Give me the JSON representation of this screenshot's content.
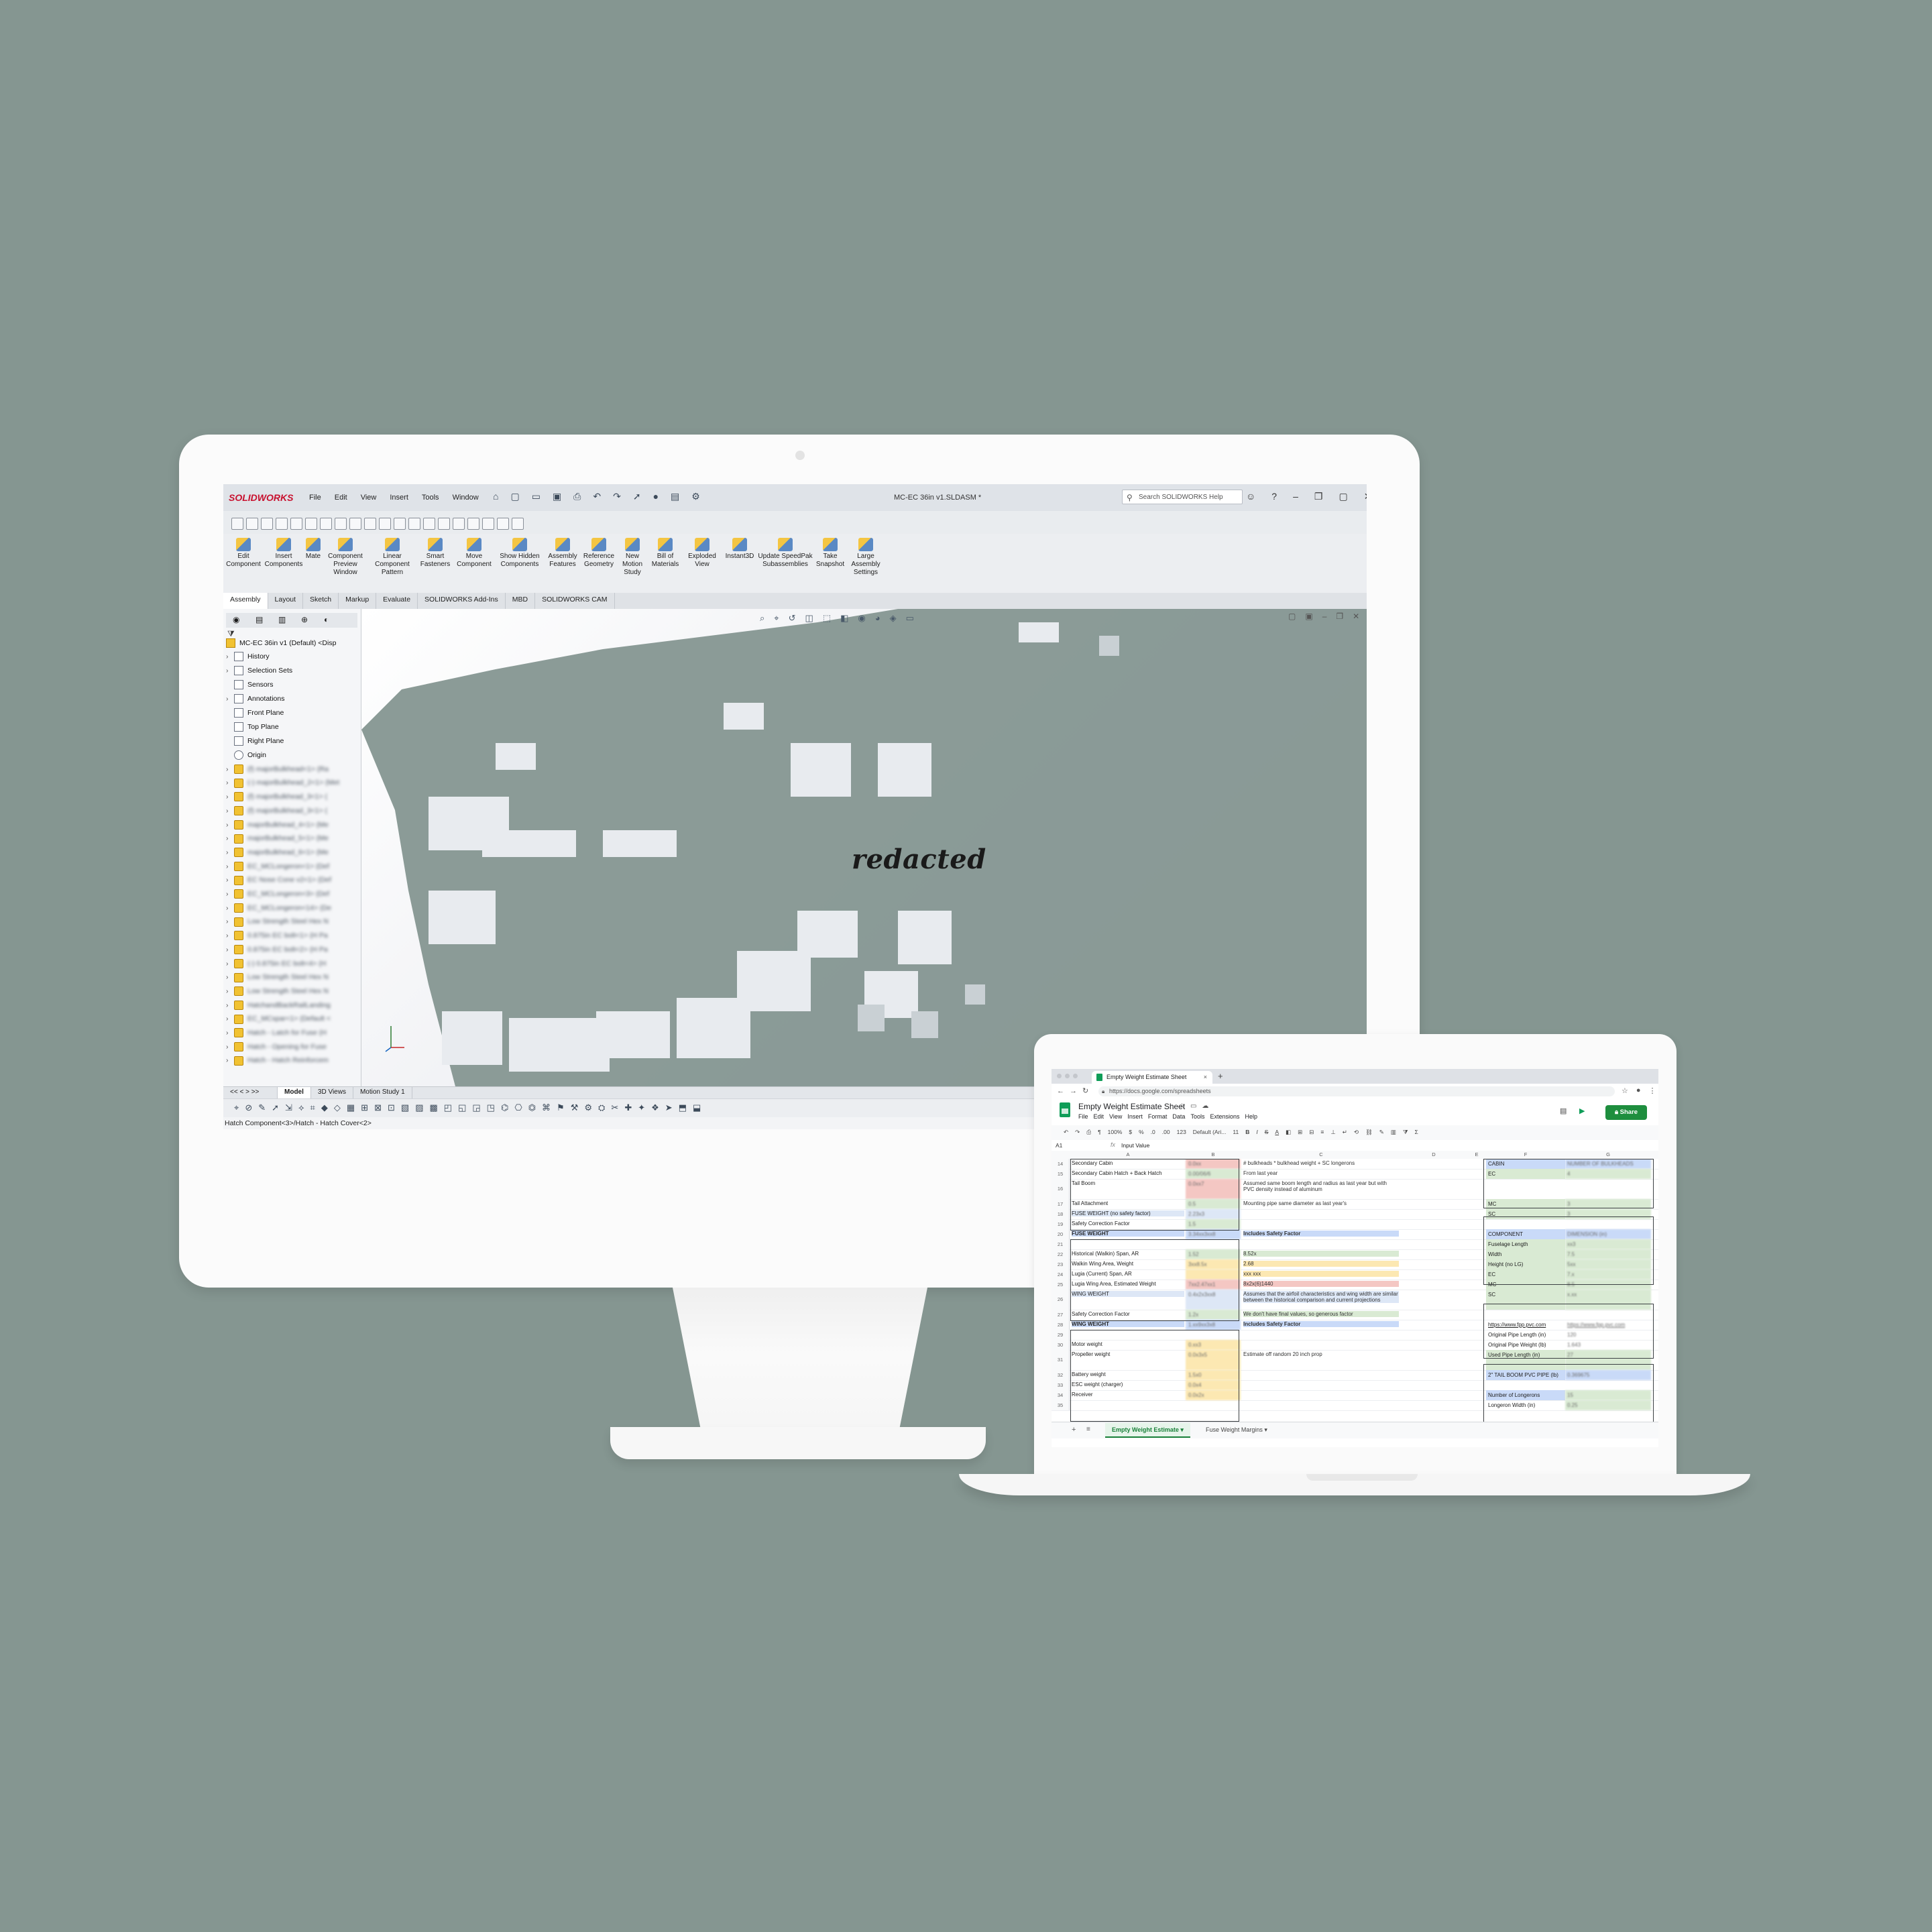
{
  "solidworks": {
    "logo": "SOLIDWORKS",
    "menu": [
      "File",
      "Edit",
      "View",
      "Insert",
      "Tools",
      "Window"
    ],
    "document_title": "MC-EC 36in v1.SLDASM *",
    "search_placeholder": "Search SOLIDWORKS Help",
    "commands": [
      "Edit Component",
      "Insert Components",
      "Mate",
      "Component Preview Window",
      "Linear Component Pattern",
      "Smart Fasteners",
      "Move Component",
      "Show Hidden Components",
      "Assembly Features",
      "Reference Geometry",
      "New Motion Study",
      "Bill of Materials",
      "Exploded View",
      "Instant3D",
      "Update SpeedPak Subassemblies",
      "Take Snapshot",
      "Large Assembly Settings"
    ],
    "tabs": [
      "Assembly",
      "Layout",
      "Sketch",
      "Markup",
      "Evaluate",
      "SOLIDWORKS Add-Ins",
      "MBD",
      "SOLIDWORKS CAM"
    ],
    "active_tab": "Assembly",
    "tree_root": "MC-EC 36in v1 (Default) <Disp",
    "tree_items": [
      "History",
      "Selection Sets",
      "Sensors",
      "Annotations",
      "Front Plane",
      "Top Plane",
      "Right Plane",
      "Origin"
    ],
    "tree_components_blurred": [
      "(f) majorBulkhead<1> (Ra",
      "(-) majorBulkhead_2<1> (Met",
      "(f) majorBulkhead_3<1> (",
      "(f) majorBulkhead_3<1> (",
      "majorBulkhead_4<1> (Me",
      "majorBulkhead_5<1> (Me",
      "majorBulkhead_6<1> (Me",
      "EC_MCLongeron<1> (Def",
      "EC Nose Cone v2<1> (Def",
      "EC_MCLongeron<3> (Def",
      "EC_MCLongeron<14> (De",
      "Low Strength Steel Hex N",
      "0.875in EC bolt<1> (H Pa",
      "0.875in EC bolt<2> (H Pa",
      "(-) 0.875in EC bolt<4> (H",
      "Low Strength Steel Hex N",
      "Low Strength Steel Hex N",
      "HatchandBackRailLanding",
      "EC_MCspar<1> (Default <",
      "Hatch - Latch for Fuse (H",
      "Hatch - Opening for Fuse",
      "Hatch - Hatch Reinforcem"
    ],
    "bottom_tabs": [
      "Model",
      "3D Views",
      "Motion Study 1"
    ],
    "status": "Hatch Component<3>/Hatch - Hatch Cover<2>",
    "redacted_label": "redacted"
  },
  "sheets": {
    "tab_title": "Empty Weight Estimate Sheet",
    "url": "https://docs.google.com/spreadsheets",
    "doc_title": "Empty Weight Estimate Sheet",
    "menu": [
      "File",
      "Edit",
      "View",
      "Insert",
      "Format",
      "Data",
      "Tools",
      "Extensions",
      "Help"
    ],
    "share": "Share",
    "toolbar": [
      "100%",
      "$",
      "%",
      ".0",
      ".00",
      "123",
      "Default (Ari...",
      "11",
      "B",
      "I",
      "S",
      "A"
    ],
    "name_box": "A1",
    "formula_value": "Input Value",
    "columns": [
      "A",
      "B",
      "C",
      "D",
      "E",
      "F",
      "G"
    ],
    "rows": [
      {
        "n": "14",
        "a": "Secondary Cabin",
        "b": "0.0xx",
        "c": "# bulkheads * bulkhead weight + SC longerons",
        "f": "CABIN",
        "g": "NUMBER OF BULKHEADS"
      },
      {
        "n": "15",
        "a": "Secondary Cabin Hatch + Back Hatch",
        "b": "0.00/06/6",
        "c": "From last year",
        "f": "EC",
        "g": "4"
      },
      {
        "n": "16",
        "a": "Tail Boom",
        "b": "0.0xx7",
        "c": "Assumed same boom length and radius as last year but with PVC density instead of aluminum",
        "f": "",
        "g": ""
      },
      {
        "n": "17",
        "a": "Tail Attachment",
        "b": "0.5",
        "c": "Mounting pipe same diameter as last year's",
        "f": "MC",
        "g": "3"
      },
      {
        "n": "18",
        "a": "FUSE WEIGHT (no safety factor)",
        "b": "2.23x3",
        "c": "",
        "f": "SC",
        "g": "3"
      },
      {
        "n": "19",
        "a": "Safety Correction Factor",
        "b": "1.5",
        "c": "",
        "f": "",
        "g": ""
      },
      {
        "n": "20",
        "a": "FUSE WEIGHT",
        "b": "3.34xx3xx8",
        "c": "Includes Safety Factor",
        "f": "COMPONENT",
        "g": "DIMENSION (in)"
      },
      {
        "n": "21",
        "a": "",
        "b": "",
        "c": "",
        "f": "Fuselage Length",
        "g": "xx3"
      },
      {
        "n": "22",
        "a": "Historical (Walkin) Span, AR",
        "b": "1.52",
        "c": "8.52x",
        "f": "Width",
        "g": "7.5"
      },
      {
        "n": "23",
        "a": "Walkin Wing Area, Weight",
        "b": "3xx8.5x",
        "c": "2.68",
        "f": "Height (no LG)",
        "g": "5xx"
      },
      {
        "n": "24",
        "a": "Lugia (Current) Span, AR",
        "b": "",
        "c": "xxx xxx",
        "f": "EC",
        "g": "7.x"
      },
      {
        "n": "25",
        "a": "Lugia Wing Area, Estimated Weight",
        "b": "7xx2.47xx1",
        "c": "8x2x(6)1440",
        "f": "MC",
        "g": "8.5"
      },
      {
        "n": "26",
        "a": "WING WEIGHT",
        "b": "0.4x2x3xx8",
        "c": "Assumes that the airfoil characteristics and wing width are similar between the historical comparison and current projections",
        "f": "SC",
        "g": "x.xx"
      },
      {
        "n": "27",
        "a": "Safety Correction Factor",
        "b": "1.2x",
        "c": "We don't have final values, so generous factor",
        "f": "",
        "g": ""
      },
      {
        "n": "28",
        "a": "WING WEIGHT",
        "b": "1.xx9xx3x8",
        "c": "Includes Safety Factor",
        "f": "https://www.fpp.pvc.com",
        "g": "https://www.fpp.pvc.com"
      },
      {
        "n": "29",
        "a": "",
        "b": "",
        "c": "",
        "f": "Original Pipe Length (in)",
        "g": "120"
      },
      {
        "n": "30",
        "a": "Motor weight",
        "b": "0.xx3",
        "c": "",
        "f": "Original Pipe Weight (lb)",
        "g": "1.643"
      },
      {
        "n": "31",
        "a": "Propeller weight",
        "b": "0.0x3x5",
        "c": "Estimate off random 20 inch prop",
        "f": "Used Pipe Length (in)",
        "g": "27"
      },
      {
        "n": "32",
        "a": "Battery weight",
        "b": "1.5x0",
        "c": "",
        "f": "2\" TAIL BOOM PVC PIPE (lb)",
        "g": "0.369675"
      },
      {
        "n": "33",
        "a": "ESC weight (charger)",
        "b": "0.0x4",
        "c": "",
        "f": "",
        "g": ""
      },
      {
        "n": "34",
        "a": "Receiver",
        "b": "0.0x2x",
        "c": "",
        "f": "Number of Longerons",
        "g": "15"
      },
      {
        "n": "35",
        "a": "",
        "b": "",
        "c": "",
        "f": "Longeron Width (in)",
        "g": "0.25"
      }
    ],
    "sheet_tabs": [
      "Empty Weight Estimate",
      "Fuse Weight Margins"
    ],
    "active_sheet": "Empty Weight Estimate"
  }
}
